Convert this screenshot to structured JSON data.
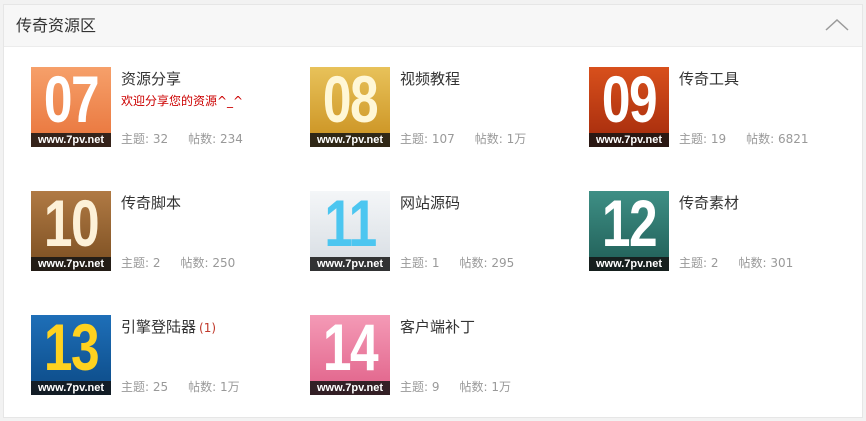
{
  "panel": {
    "title": "传奇资源区",
    "collapse_icon": "chevron-up-icon"
  },
  "colors": {
    "accent_red": "#cc0000",
    "stats_gray": "#999999"
  },
  "stats_labels": {
    "topics": "主题:",
    "posts": "帖数:"
  },
  "forums": [
    {
      "number": "07",
      "site": "www.7pv.net",
      "name": "资源分享",
      "description": "欢迎分享您的资源^_^",
      "new_count": "",
      "topics": "32",
      "posts": "234",
      "tile_bg": "linear-gradient(180deg,#f6a06a,#e8733a)",
      "tile_fg": "#ffffff"
    },
    {
      "number": "08",
      "site": "www.7pv.net",
      "name": "视频教程",
      "description": "",
      "new_count": "",
      "topics": "107",
      "posts": "1万",
      "tile_bg": "linear-gradient(180deg,#e8c25a,#c98f1e)",
      "tile_fg": "#fff7d6"
    },
    {
      "number": "09",
      "site": "www.7pv.net",
      "name": "传奇工具",
      "description": "",
      "new_count": "",
      "topics": "19",
      "posts": "6821",
      "tile_bg": "linear-gradient(180deg,#d8501c,#a32a0c)",
      "tile_fg": "#ffffff"
    },
    {
      "number": "10",
      "site": "www.7pv.net",
      "name": "传奇脚本",
      "description": "",
      "new_count": "",
      "topics": "2",
      "posts": "250",
      "tile_bg": "linear-gradient(180deg,#b07a44,#7a4d20)",
      "tile_fg": "#fdf1d8"
    },
    {
      "number": "11",
      "site": "www.7pv.net",
      "name": "网站源码",
      "description": "",
      "new_count": "",
      "topics": "1",
      "posts": "295",
      "tile_bg": "linear-gradient(180deg,#f4f6f8,#d6dce2)",
      "tile_fg": "#4cc6f0"
    },
    {
      "number": "12",
      "site": "www.7pv.net",
      "name": "传奇素材",
      "description": "",
      "new_count": "",
      "topics": "2",
      "posts": "301",
      "tile_bg": "linear-gradient(180deg,#3e8f85,#1f5c55)",
      "tile_fg": "#ffffff"
    },
    {
      "number": "13",
      "site": "www.7pv.net",
      "name": "引擎登陆器",
      "description": "",
      "new_count": "(1)",
      "topics": "25",
      "posts": "1万",
      "tile_bg": "linear-gradient(180deg,#1e6fb8,#0c4a86)",
      "tile_fg": "#ffd21f"
    },
    {
      "number": "14",
      "site": "www.7pv.net",
      "name": "客户端补丁",
      "description": "",
      "new_count": "",
      "topics": "9",
      "posts": "1万",
      "tile_bg": "linear-gradient(180deg,#f49ab6,#e06088)",
      "tile_fg": "#ffffff"
    }
  ]
}
